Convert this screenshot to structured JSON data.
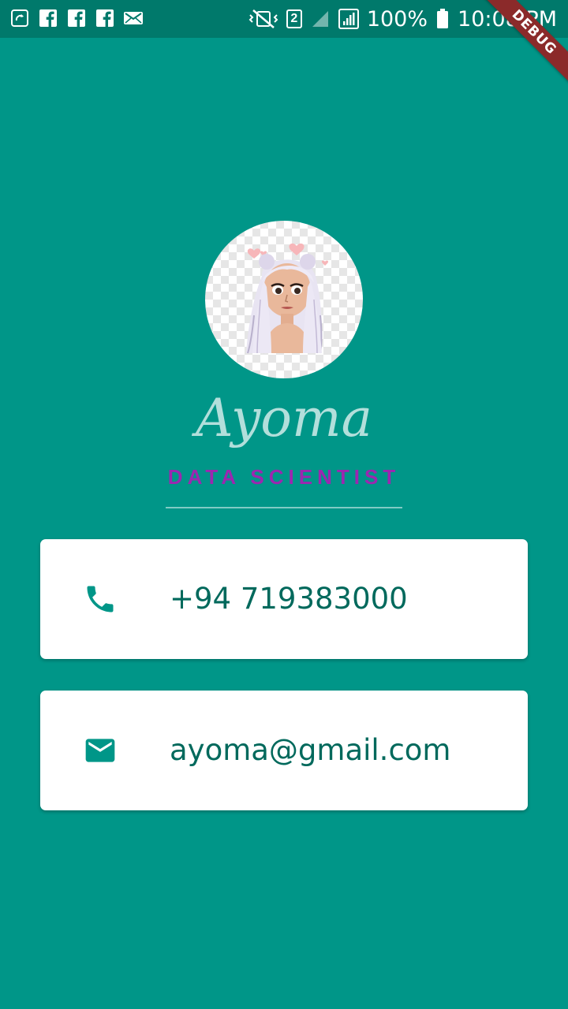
{
  "status_bar": {
    "battery_percent": "100%",
    "time": "10:08 PM",
    "sim_slot": "2",
    "left_icons": [
      "sync-icon",
      "facebook-icon",
      "facebook-icon",
      "facebook-icon",
      "mail-icon"
    ],
    "right_icons": [
      "mute-vibrate-icon",
      "sim-2-icon",
      "signal-icon",
      "signal-bars-icon",
      "battery-icon"
    ]
  },
  "debug_banner": "DEBUG",
  "profile": {
    "name": "Ayoma",
    "title": "DATA SCIENTIST",
    "avatar": "cartoon-girl-avatar"
  },
  "contacts": [
    {
      "icon": "phone-icon",
      "value": "+94 719383000"
    },
    {
      "icon": "email-icon",
      "value": "ayoma@gmail.com"
    }
  ],
  "colors": {
    "background": "#009688",
    "status_bar": "#00796B",
    "name_text": "#B2DFDB",
    "title_text": "#9C27B0",
    "card_text": "#00695C",
    "card_icon": "#009688",
    "debug_ribbon": "#8B2A2A"
  }
}
